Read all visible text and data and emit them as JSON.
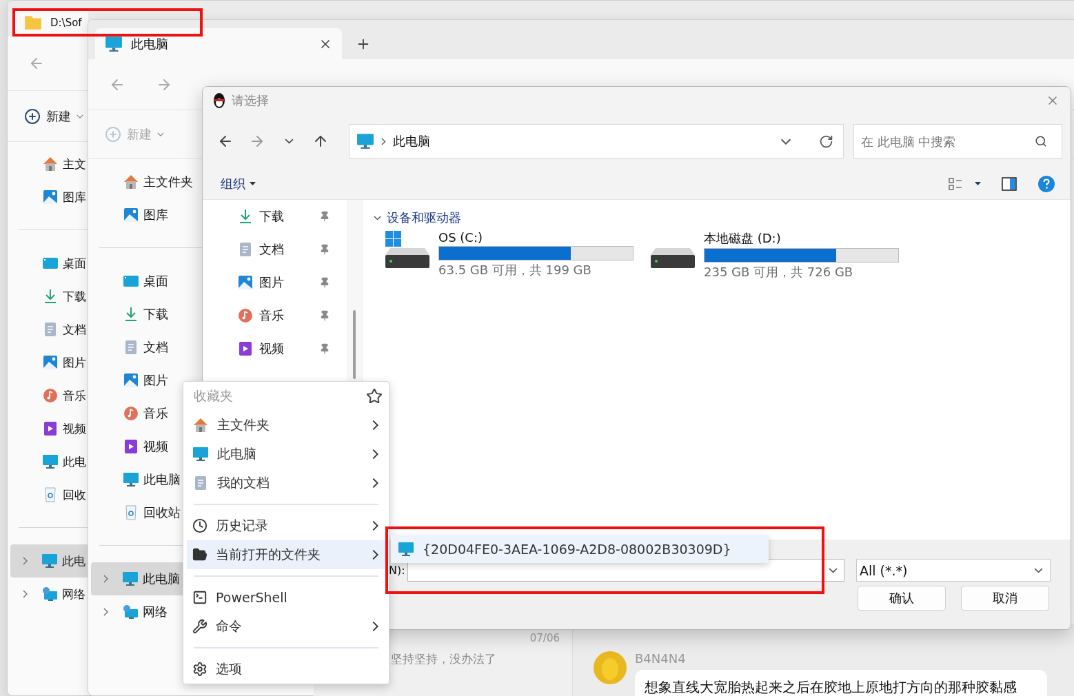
{
  "back_window": {
    "tab": "D:\\Sof",
    "new": {
      "label": "新建",
      "disabled": false
    },
    "quick": [
      {
        "label": "主文"
      },
      {
        "label": "图库"
      }
    ],
    "places": [
      {
        "label": "桌面"
      },
      {
        "label": "下载"
      },
      {
        "label": "文档"
      },
      {
        "label": "图片"
      },
      {
        "label": "音乐"
      },
      {
        "label": "视频"
      },
      {
        "label": "此电"
      },
      {
        "label": "回收"
      }
    ],
    "tree": [
      {
        "label": "此电",
        "selected": true
      },
      {
        "label": "网络",
        "selected": false
      }
    ]
  },
  "explorer": {
    "tab": "此电脑",
    "new": {
      "label": "新建",
      "disabled": true
    },
    "quick": [
      {
        "label": "主文件夹"
      },
      {
        "label": "图库"
      }
    ],
    "places": [
      {
        "label": "桌面"
      },
      {
        "label": "下载"
      },
      {
        "label": "文档"
      },
      {
        "label": "图片"
      },
      {
        "label": "音乐"
      },
      {
        "label": "视频"
      },
      {
        "label": "此电脑"
      },
      {
        "label": "回收站"
      }
    ],
    "tree": [
      {
        "label": "此电脑",
        "selected": true
      },
      {
        "label": "网络",
        "selected": false
      }
    ]
  },
  "chat": {
    "date": "07/06",
    "preview": "坚持坚持，没办法了",
    "sender": "B4N4N4",
    "message": "想象直线大宽胎热起来之后在胶地上原地打方向的那种胶黏感"
  },
  "dialog": {
    "title": "请选择",
    "address": "此电脑",
    "search_placeholder": "在 此电脑 中搜索",
    "organize": "组织",
    "nav": [
      {
        "label": "下载",
        "pinned": true
      },
      {
        "label": "文档",
        "pinned": true
      },
      {
        "label": "图片",
        "pinned": true
      },
      {
        "label": "音乐",
        "pinned": true
      },
      {
        "label": "视频",
        "pinned": true
      }
    ],
    "group": "设备和驱动器",
    "drives": [
      {
        "name": "OS (C:)",
        "kind": "system",
        "level": 0.68,
        "info": "63.5 GB 可用，共 199 GB"
      },
      {
        "name": "本地磁盘 (D:)",
        "kind": "data",
        "level": 0.68,
        "info": "235 GB 可用，共 726 GB"
      }
    ],
    "filename_label": "N):",
    "filter": "All (*.*)",
    "buttons": [
      "确认",
      "取消"
    ]
  },
  "menu": {
    "header": "收藏夹",
    "items": [
      {
        "kind": "item",
        "label": "主文件夹",
        "submenu": true,
        "selected": false
      },
      {
        "kind": "item",
        "label": "此电脑",
        "submenu": true,
        "selected": false
      },
      {
        "kind": "item",
        "label": "我的文档",
        "submenu": true,
        "selected": false
      },
      {
        "kind": "separator"
      },
      {
        "kind": "item",
        "label": "历史记录",
        "submenu": true,
        "selected": false
      },
      {
        "kind": "item",
        "label": "当前打开的文件夹",
        "submenu": true,
        "selected": true
      },
      {
        "kind": "separator"
      },
      {
        "kind": "item",
        "label": "PowerShell",
        "submenu": false,
        "selected": false
      },
      {
        "kind": "item",
        "label": "命令",
        "submenu": true,
        "selected": false
      },
      {
        "kind": "separator"
      },
      {
        "kind": "item",
        "label": "选项",
        "submenu": false,
        "selected": false
      }
    ]
  },
  "submenu": {
    "items": [
      {
        "label": "{20D04FE0-3AEA-1069-A2D8-08002B30309D}",
        "selected": true
      }
    ]
  },
  "highlights": [
    {
      "kind": "frame"
    },
    {
      "kind": "frame"
    }
  ]
}
